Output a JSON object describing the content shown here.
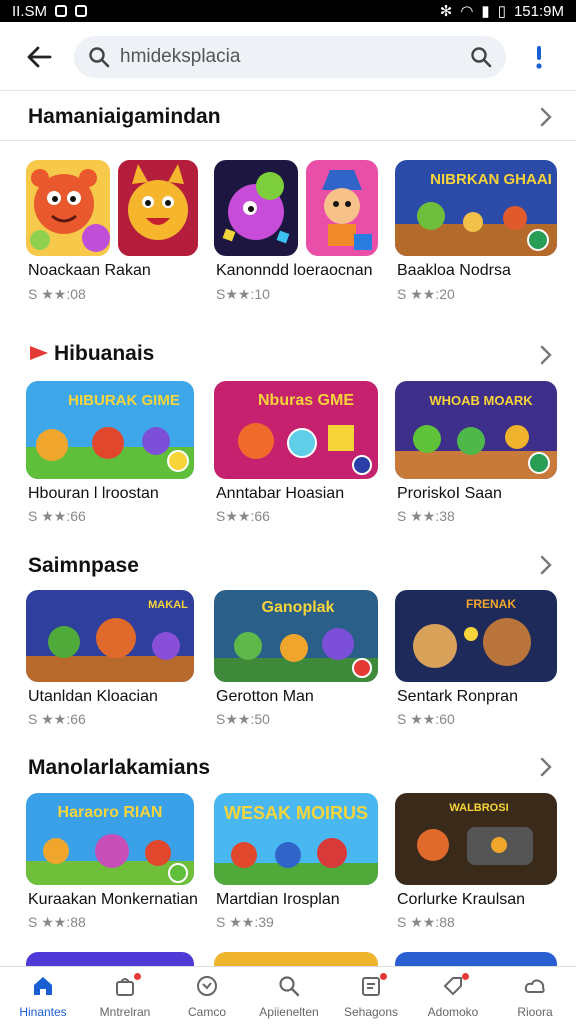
{
  "status": {
    "left": "II.SM",
    "time": "151:9M"
  },
  "search": {
    "query": "hmideksplacia"
  },
  "sections": [
    {
      "title": "Hamaniaigamindan",
      "cards": [
        {
          "title": "Noackaan Rakan",
          "rating": "S ★★:08"
        },
        {
          "title": "Kanonndd loeraocnan",
          "rating": "S★★:10"
        },
        {
          "title": "Baakloa Nodrsa",
          "rating": "S ★★:20",
          "art_text": "NIBRKAN GHAAI"
        }
      ]
    },
    {
      "title": "Hibuanais",
      "cards": [
        {
          "title": "Hbouran l lroostan",
          "rating": "S ★★:66",
          "art_text": "HIBURAK GIME"
        },
        {
          "title": "Anntabar Hoasian",
          "rating": "S★★:66",
          "art_text": "Nburas GME"
        },
        {
          "title": "ProriskoI Saan",
          "rating": "S ★★:38",
          "art_text": "WHOAB MOARK"
        }
      ]
    },
    {
      "title": "Saimnpase",
      "cards": [
        {
          "title": "Utanldan Kloacian",
          "rating": "S ★★:66",
          "art_text": "MAKAL"
        },
        {
          "title": "Gerotton Man",
          "rating": "S★★:50",
          "art_text": "Ganoplak"
        },
        {
          "title": "Sentark Ronpran",
          "rating": "S ★★:60",
          "art_text": "FRENAK"
        }
      ]
    },
    {
      "title": "Manolarlakamians",
      "cards": [
        {
          "title": "Kuraakan Monkernatian",
          "rating": "S ★★:88",
          "art_text": "Haraoro RIAN"
        },
        {
          "title": "Martdian Irosplan",
          "rating": "S ★★:39",
          "art_text": "WESAK MOIRUS"
        },
        {
          "title": "Corlurke Kraulsan",
          "rating": "S ★★:88",
          "art_text": "WALBROSI"
        }
      ]
    }
  ],
  "nav": [
    {
      "label": "Hinantes",
      "icon": "home-icon",
      "active": true
    },
    {
      "label": "Mntrelran",
      "icon": "bag-icon"
    },
    {
      "label": "Camco",
      "icon": "compass-icon"
    },
    {
      "label": "Apiienelten",
      "icon": "search-icon"
    },
    {
      "label": "Sehagons",
      "icon": "note-icon"
    },
    {
      "label": "Adomoko",
      "icon": "tag-icon"
    },
    {
      "label": "Rioora",
      "icon": "cloud-icon"
    }
  ],
  "colors": {
    "accent": "#1a5fd1",
    "youtube_red": "#e53935"
  }
}
